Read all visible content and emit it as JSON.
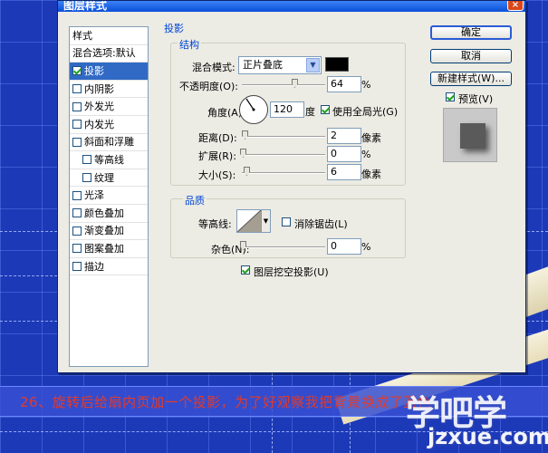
{
  "window": {
    "title": "图层样式",
    "close": "×"
  },
  "style_list": {
    "items": [
      {
        "label": "样式",
        "type": "header"
      },
      {
        "label": "混合选项:默认",
        "type": "header"
      },
      {
        "label": "投影",
        "checked": true,
        "selected": true
      },
      {
        "label": "内阴影",
        "checked": false
      },
      {
        "label": "外发光",
        "checked": false
      },
      {
        "label": "内发光",
        "checked": false
      },
      {
        "label": "斜面和浮雕",
        "checked": false
      },
      {
        "label": "等高线",
        "checked": false,
        "sub": true
      },
      {
        "label": "纹理",
        "checked": false,
        "sub": true
      },
      {
        "label": "光泽",
        "checked": false
      },
      {
        "label": "颜色叠加",
        "checked": false
      },
      {
        "label": "渐变叠加",
        "checked": false
      },
      {
        "label": "图案叠加",
        "checked": false
      },
      {
        "label": "描边",
        "checked": false
      }
    ]
  },
  "shadow": {
    "section_title": "投影",
    "structure_title": "结构",
    "blend_mode_label": "混合模式:",
    "blend_mode_value": "正片叠底",
    "shadow_color": "#000000",
    "opacity_label": "不透明度(O):",
    "opacity_value": "64",
    "opacity_level": 0.64,
    "percent": "%",
    "angle_label": "角度(A):",
    "angle_value": "120",
    "degree_unit": "度",
    "global_light_label": "使用全局光(G)",
    "global_light_checked": true,
    "distance_label": "距离(D):",
    "distance_value": "2",
    "distance_unit": "像素",
    "spread_label": "扩展(R):",
    "spread_value": "0",
    "spread_unit": "%",
    "size_label": "大小(S):",
    "size_value": "6",
    "size_unit": "像素"
  },
  "quality": {
    "title": "品质",
    "contour_label": "等高线:",
    "anti_alias_label": "消除锯齿(L)",
    "anti_alias_checked": false,
    "noise_label": "杂色(N):",
    "noise_value": "0",
    "noise_unit": "%",
    "knockout_label": "图层挖空投影(U)",
    "knockout_checked": true
  },
  "buttons": {
    "ok": "确定",
    "cancel": "取消",
    "new_style": "新建样式(W)...",
    "preview_label": "预览(V)",
    "preview_checked": true
  },
  "caption": "26、旋转后给扇内页加一个投影，为了好观察我把背景换成了蓝色",
  "watermark": {
    "brand": "学吧学",
    "site": "jzxue.com"
  },
  "colors": {
    "accent": "#0046d5",
    "selection": "#316ac5",
    "caption_text": "#e33a2a",
    "background": "#1c39b8"
  }
}
